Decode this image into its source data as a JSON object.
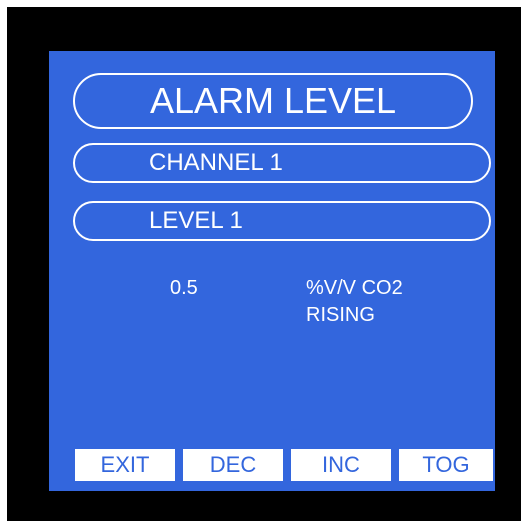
{
  "header": {
    "title": "ALARM LEVEL"
  },
  "selection": {
    "channel": "CHANNEL 1",
    "level": "LEVEL 1"
  },
  "reading": {
    "value": "0.5",
    "unit": "%V/V CO2",
    "direction": "RISING"
  },
  "softkeys": {
    "exit": "EXIT",
    "dec": "DEC",
    "inc": "INC",
    "tog": "TOG"
  },
  "colors": {
    "screen_background": "#3366dd",
    "bezel": "#000000",
    "text": "#ffffff"
  }
}
